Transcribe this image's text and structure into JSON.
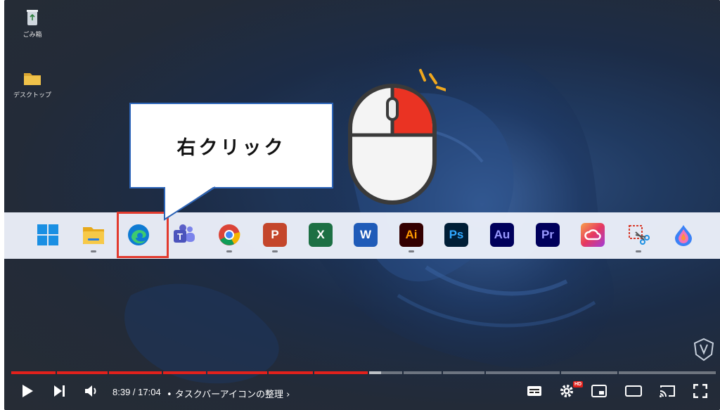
{
  "callout": {
    "text": "右クリック"
  },
  "desktop": {
    "icons": [
      {
        "name": "recycle-bin",
        "label": "ごみ箱"
      },
      {
        "name": "folder",
        "label": "デスクトップ"
      }
    ]
  },
  "taskbar": {
    "icons": [
      {
        "id": "start",
        "label": "",
        "color": "#1a8fe3",
        "running": false
      },
      {
        "id": "explorer",
        "label": "",
        "color": "#f4bd2a",
        "running": true
      },
      {
        "id": "edge",
        "label": "",
        "color": "#0f7bd3",
        "running": false
      },
      {
        "id": "teams",
        "label": "T",
        "color": "#5b5fc7",
        "running": false
      },
      {
        "id": "chrome",
        "label": "",
        "color": "#db4437",
        "running": true
      },
      {
        "id": "powerpoint",
        "label": "P",
        "color": "#c4462b",
        "running": true
      },
      {
        "id": "excel",
        "label": "X",
        "color": "#1d7044",
        "running": false
      },
      {
        "id": "word",
        "label": "W",
        "color": "#1f5bb8",
        "running": false
      },
      {
        "id": "illustrator",
        "label": "Ai",
        "color": "#330000",
        "fg": "#ff9a00",
        "running": true
      },
      {
        "id": "photoshop",
        "label": "Ps",
        "color": "#001e36",
        "fg": "#31a8ff",
        "running": false
      },
      {
        "id": "audition",
        "label": "Au",
        "color": "#00005b",
        "fg": "#9999ff",
        "running": false
      },
      {
        "id": "premiere",
        "label": "Pr",
        "color": "#00005b",
        "fg": "#9999ff",
        "running": false
      },
      {
        "id": "creative-cloud",
        "label": "",
        "color": "#e6395f",
        "running": false
      },
      {
        "id": "snipping-tool",
        "label": "",
        "color": "#e3e3e3",
        "running": true
      },
      {
        "id": "paint",
        "label": "",
        "color": "#3b82f6",
        "running": false
      }
    ]
  },
  "player": {
    "time": "8:39 / 17:04",
    "chapter": "• タスクバーアイコンの整理",
    "chapter_chevron": "›",
    "progress_fraction": 0.506,
    "buffered_fraction": 0.525,
    "hd_badge": "HD",
    "accent": "#e2211c"
  }
}
